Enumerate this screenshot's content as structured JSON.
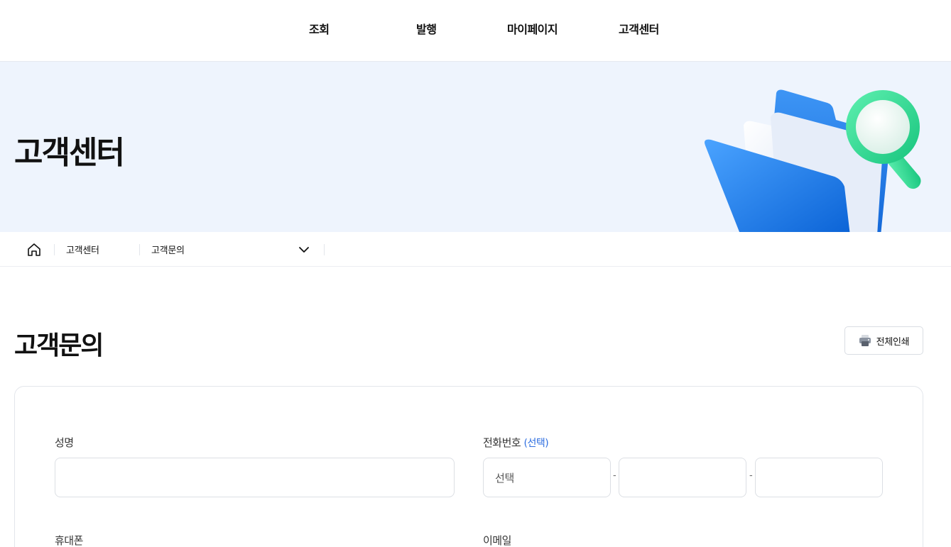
{
  "gnb": {
    "items": [
      {
        "label": "조회"
      },
      {
        "label": "발행"
      },
      {
        "label": "마이페이지"
      },
      {
        "label": "고객센터"
      }
    ]
  },
  "hero": {
    "title": "고객센터",
    "illustration_icon": "folder-magnifier-icon"
  },
  "breadcrumb": {
    "home_icon": "home-icon",
    "level1": "고객센터",
    "level2": "고객문의",
    "dropdown_icon": "chevron-down-icon"
  },
  "page": {
    "title": "고객문의",
    "print_label": "전체인쇄",
    "print_icon": "printer-icon"
  },
  "form": {
    "name_label": "성명",
    "name_value": "",
    "phone_label": "전화번호",
    "phone_optional": "(선택)",
    "phone_select_value": "선택",
    "phone_mid_value": "",
    "phone_last_value": "",
    "phone_separator": "-",
    "mobile_label": "휴대폰",
    "email_label": "이메일"
  },
  "colors": {
    "accent": "#2f6fe0",
    "hero_bg": "#eef4fd",
    "border": "#dcdfe4"
  }
}
